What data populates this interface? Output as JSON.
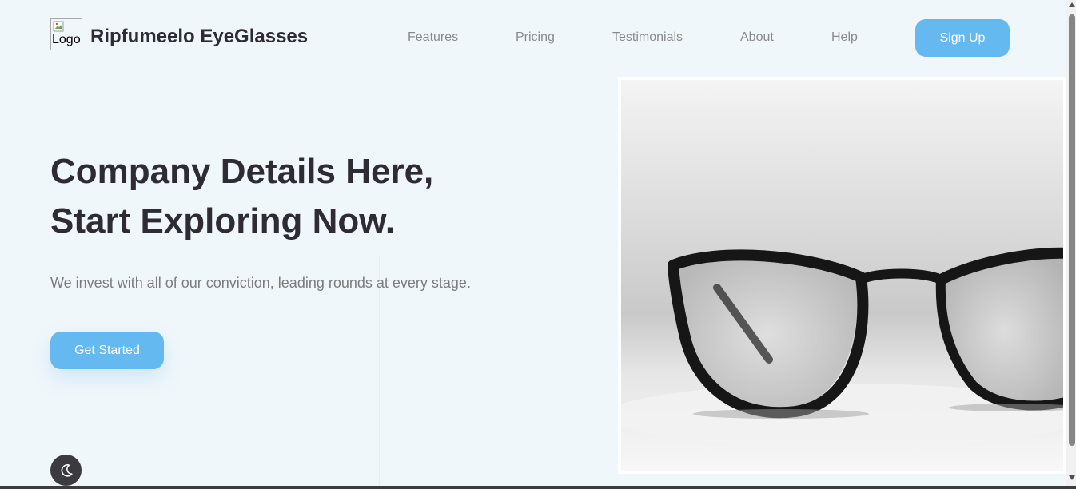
{
  "header": {
    "logo_alt": "Logo",
    "brand": "Ripfumeelo EyeGlasses",
    "nav": [
      {
        "label": "Features"
      },
      {
        "label": "Pricing"
      },
      {
        "label": "Testimonials"
      },
      {
        "label": "About"
      },
      {
        "label": "Help"
      }
    ],
    "signup_label": "Sign Up"
  },
  "hero": {
    "title_line1": "Company Details Here,",
    "title_line2": "Start Exploring Now.",
    "subtitle": "We invest with all of our conviction, leading rounds at every stage.",
    "cta_label": "Get Started",
    "image_icon": "eyeglasses-photo"
  },
  "theme_toggle": {
    "icon": "moon-icon"
  },
  "colors": {
    "background": "#f0f7fb",
    "accent": "#64b9f1",
    "heading": "#2e2b35",
    "muted": "#7c7c7c"
  }
}
